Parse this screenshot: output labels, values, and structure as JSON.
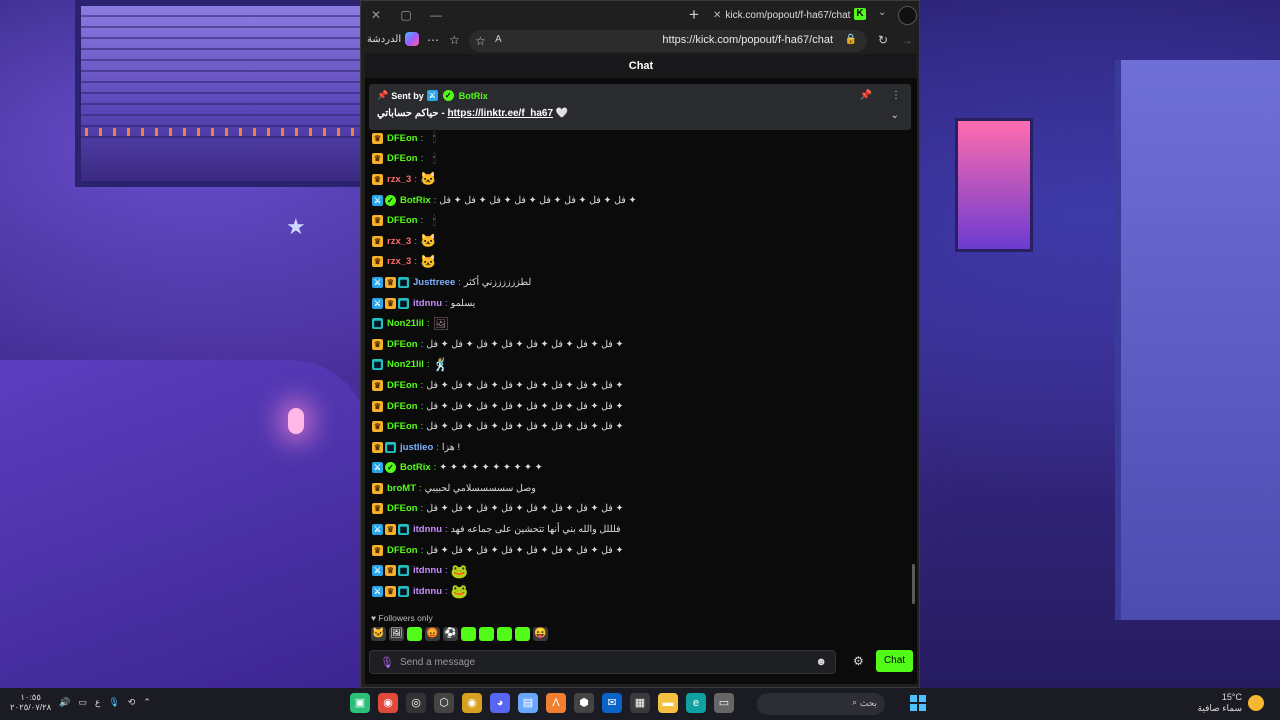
{
  "browser": {
    "tab_title": "kick.com/popout/f-ha67/chat",
    "tab_favicon": "K",
    "copilot_label": "الدردشة",
    "url": "https://kick.com/popout/f-ha67/chat"
  },
  "chat": {
    "header": "Chat",
    "pinned": {
      "sent_by_label": "Sent by",
      "sender": "BotRix",
      "message_prefix": "حياكم حساباتي -",
      "link": "https://linktr.ee/f_ha67",
      "heart": "🤍"
    },
    "messages": [
      {
        "badges": [
          "crown"
        ],
        "user": "DFEon",
        "color": "#53fc18",
        "emotes": [
          "doll"
        ]
      },
      {
        "badges": [
          "crown"
        ],
        "user": "DFEon",
        "color": "#53fc18",
        "emotes": [
          "doll"
        ]
      },
      {
        "badges": [
          "crown"
        ],
        "user": "rzx_3",
        "color": "#ff6b6b",
        "emotes": [
          "cat"
        ]
      },
      {
        "badges": [
          "mod",
          "verified"
        ],
        "user": "BotRix",
        "color": "#53fc18",
        "text": "فل ✦ فل ✦ فل ✦ فل ✦ فل ✦ فل ✦ فل ✦ فل ✦"
      },
      {
        "badges": [
          "crown"
        ],
        "user": "DFEon",
        "color": "#53fc18",
        "emotes": [
          "doll"
        ]
      },
      {
        "badges": [
          "crown"
        ],
        "user": "rzx_3",
        "color": "#ff6b6b",
        "emotes": [
          "cat"
        ]
      },
      {
        "badges": [
          "crown"
        ],
        "user": "rzx_3",
        "color": "#ff6b6b",
        "emotes": [
          "cat"
        ]
      },
      {
        "badges": [
          "mod",
          "crown",
          "sub"
        ],
        "user": "Justtreee",
        "color": "#7fb2ff",
        "text": "لطززززززني أكثر"
      },
      {
        "badges": [
          "mod",
          "crown",
          "sub"
        ],
        "user": "itdnnu",
        "color": "#c78bff",
        "text": "يسلمو"
      },
      {
        "badges": [
          "sub"
        ],
        "user": "Non21lil",
        "color": "#53fc18",
        "emotes": [
          "pic"
        ]
      },
      {
        "badges": [
          "crown"
        ],
        "user": "DFEon",
        "color": "#53fc18",
        "text": "فل ✦ فل ✦ فل ✦ فل ✦ فل ✦ فل ✦ فل ✦ فل ✦"
      },
      {
        "badges": [
          "sub"
        ],
        "user": "Non21lil",
        "color": "#53fc18",
        "emotes": [
          "dance"
        ]
      },
      {
        "badges": [
          "crown"
        ],
        "user": "DFEon",
        "color": "#53fc18",
        "text": "فل ✦ فل ✦ فل ✦ فل ✦ فل ✦ فل ✦ فل ✦ فل ✦"
      },
      {
        "badges": [
          "crown"
        ],
        "user": "DFEon",
        "color": "#53fc18",
        "text": "فل ✦ فل ✦ فل ✦ فل ✦ فل ✦ فل ✦ فل ✦ فل ✦"
      },
      {
        "badges": [
          "crown"
        ],
        "user": "DFEon",
        "color": "#53fc18",
        "text": "فل ✦ فل ✦ فل ✦ فل ✦ فل ✦ فل ✦ فل ✦ فل ✦"
      },
      {
        "badges": [
          "crown",
          "sub"
        ],
        "user": "justlieo",
        "color": "#7fb2ff",
        "text": "هزا !"
      },
      {
        "badges": [
          "mod",
          "verified"
        ],
        "user": "BotRix",
        "color": "#53fc18",
        "text": "✦ ✦ ✦ ✦ ✦ ✦ ✦ ✦ ✦ ✦"
      },
      {
        "badges": [
          "crown"
        ],
        "user": "broMT",
        "color": "#53fc18",
        "text": "وصل سسسسسلامي لحبيبي"
      },
      {
        "badges": [
          "crown"
        ],
        "user": "DFEon",
        "color": "#53fc18",
        "text": "فل ✦ فل ✦ فل ✦ فل ✦ فل ✦ فل ✦ فل ✦ فل ✦"
      },
      {
        "badges": [
          "mod",
          "crown",
          "sub"
        ],
        "user": "itdnnu",
        "color": "#c78bff",
        "text": "فلللل والله بني أنها تتحشين على جماعه فهد"
      },
      {
        "badges": [
          "crown"
        ],
        "user": "DFEon",
        "color": "#53fc18",
        "text": "فل ✦ فل ✦ فل ✦ فل ✦ فل ✦ فل ✦ فل ✦ فل ✦"
      },
      {
        "badges": [
          "mod",
          "crown",
          "sub"
        ],
        "user": "itdnnu",
        "color": "#c78bff",
        "emotes": [
          "frog"
        ]
      },
      {
        "badges": [
          "mod",
          "crown",
          "sub"
        ],
        "user": "itdnnu",
        "color": "#c78bff",
        "emotes": [
          "frog"
        ]
      }
    ],
    "followers_only": "Followers only",
    "input_placeholder": "Send a message",
    "send_label": "Chat"
  },
  "taskbar": {
    "time": "١٠:٥٥",
    "date": "٢٠٢٥/٠٧/٢٨",
    "lang": "ع",
    "search_placeholder": "بحث",
    "temperature": "15°C",
    "weather_text": "سماء صافية"
  },
  "colors": {
    "kick_green": "#53fc18",
    "chat_bg": "#0b0b0c"
  }
}
